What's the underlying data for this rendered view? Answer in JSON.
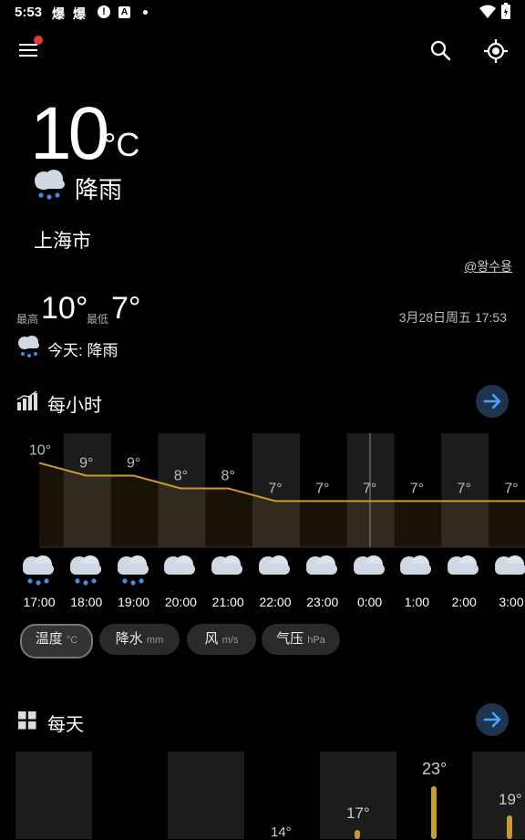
{
  "status_bar": {
    "time": "5:53",
    "app_icons": [
      "爆",
      "爆"
    ]
  },
  "current": {
    "temperature": "10",
    "unit": "°C",
    "condition": "降雨",
    "city": "上海市",
    "photo_credit": "@왕수용"
  },
  "summary": {
    "high_label": "最高",
    "high": "10°",
    "low_label": "最低",
    "low": "7°",
    "datetime": "3月28日周五 17:53",
    "today_text": "今天: 降雨"
  },
  "hourly": {
    "title": "每小时",
    "hours": [
      "17:00",
      "18:00",
      "19:00",
      "20:00",
      "21:00",
      "22:00",
      "23:00",
      "0:00",
      "1:00",
      "2:00",
      "3:00"
    ],
    "icons": [
      "rain-cloud",
      "rain-cloud",
      "rain-cloud",
      "cloud",
      "cloud",
      "cloud",
      "cloud",
      "cloud",
      "cloud",
      "cloud",
      "cloud"
    ],
    "chips": [
      {
        "label": "温度",
        "unit": "°C"
      },
      {
        "label": "降水",
        "unit": "mm"
      },
      {
        "label": "风",
        "unit": "m/s"
      },
      {
        "label": "气压",
        "unit": "hPa"
      }
    ]
  },
  "chart_data": {
    "type": "line",
    "x": [
      "17:00",
      "18:00",
      "19:00",
      "20:00",
      "21:00",
      "22:00",
      "23:00",
      "0:00",
      "1:00",
      "2:00",
      "3:00"
    ],
    "series": [
      {
        "values": [
          10,
          9,
          9,
          8,
          8,
          7,
          7,
          7,
          7,
          7,
          7
        ]
      }
    ],
    "point_labels": [
      "10°",
      "9°",
      "9°",
      "8°",
      "8°",
      "7°",
      "7°",
      "7°",
      "7°",
      "7°",
      "7°"
    ],
    "ylim": [
      5,
      11
    ],
    "grid": false
  },
  "daily": {
    "title": "每天",
    "visible_labels": [
      "14°",
      "17°",
      "23°",
      "19°"
    ]
  },
  "colors": {
    "accent_blue": "#4aa3ff",
    "line": "#c99a2e",
    "column": "#1c1c1c"
  }
}
